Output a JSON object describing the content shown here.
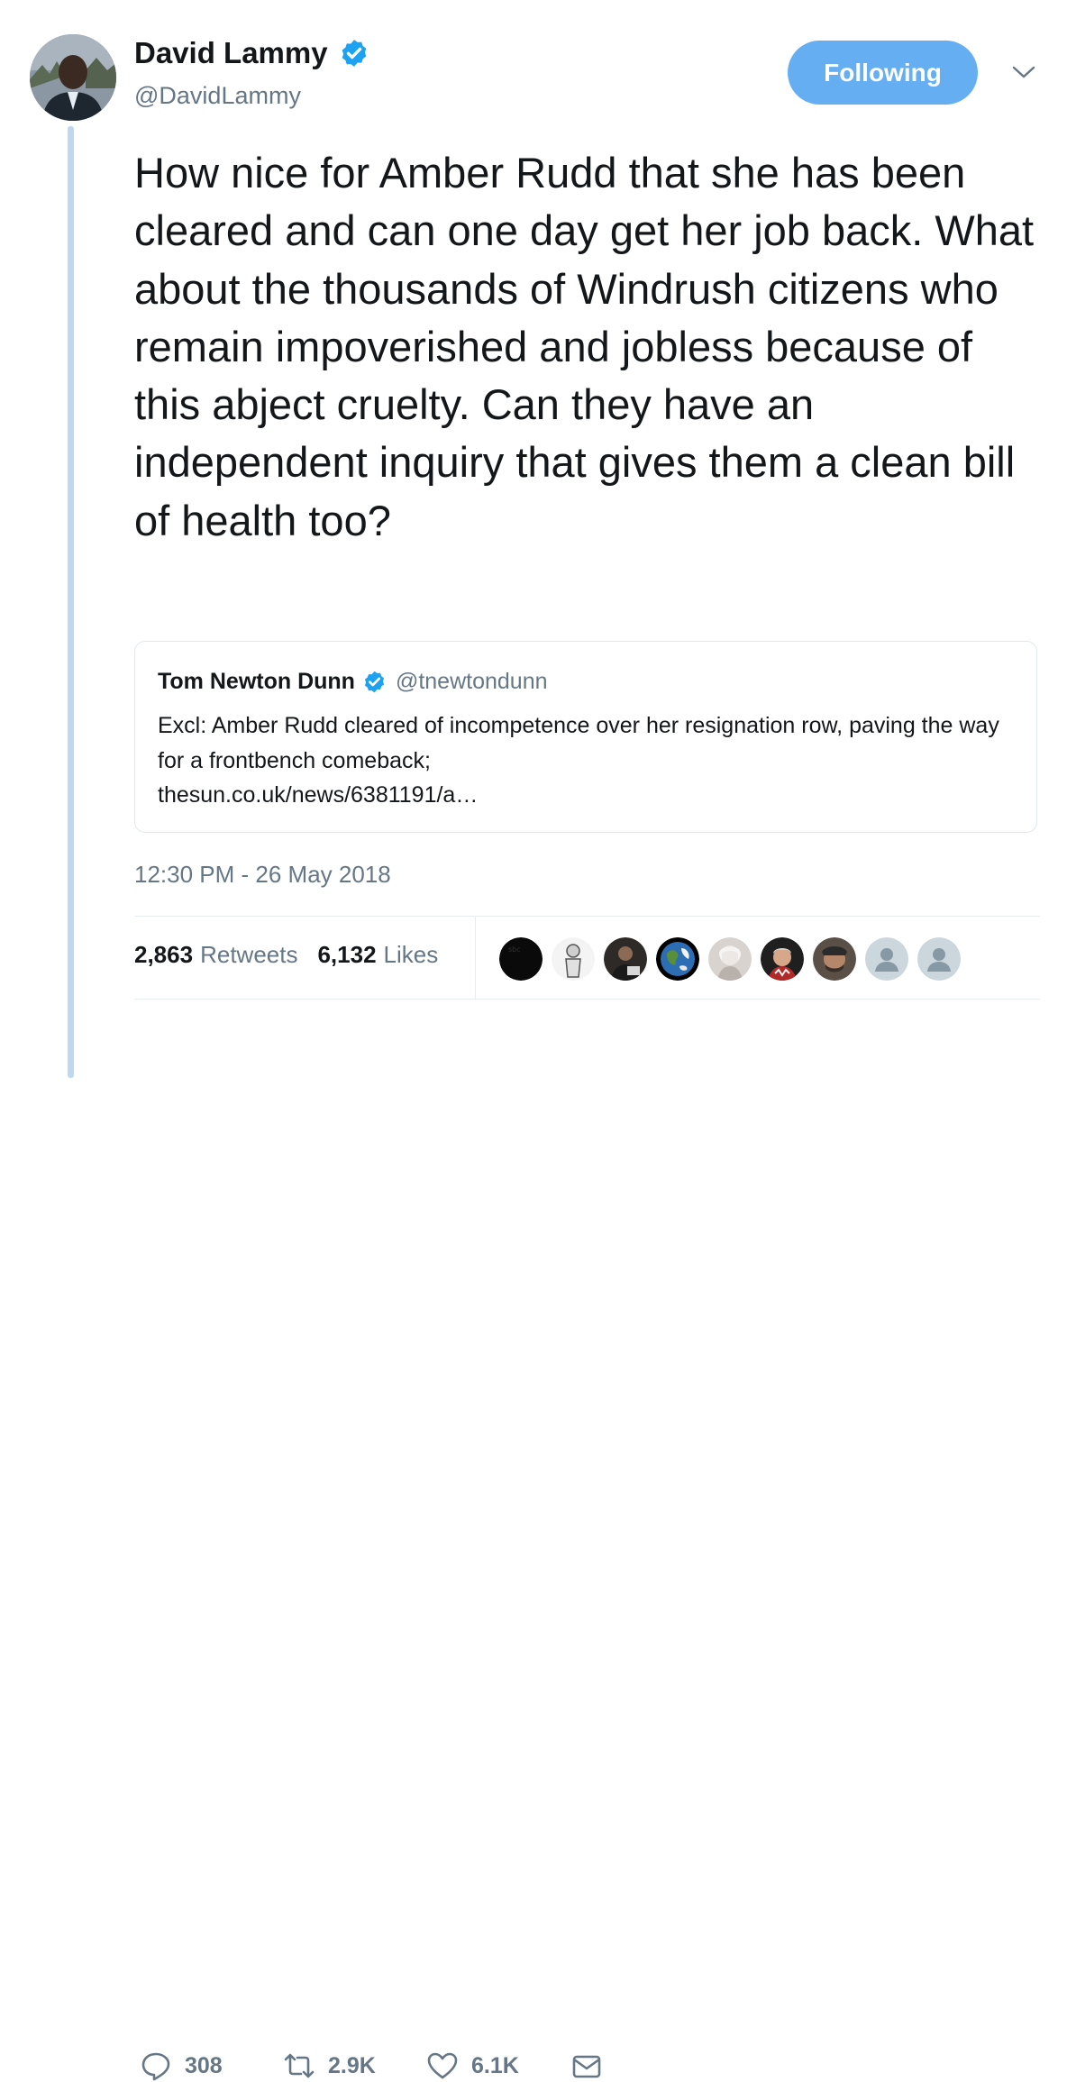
{
  "author": {
    "name": "David Lammy",
    "handle": "@DavidLammy",
    "follow_label": "Following"
  },
  "tweet": {
    "text": "How nice for Amber Rudd that she has been cleared and can one day get her job back. What about the thousands of Windrush citizens who remain impoverished and jobless because of this abject cruelty. Can they have an independent inquiry that gives them a clean bill of health too?",
    "timestamp": "12:30 PM - 26 May 2018"
  },
  "quoted": {
    "name": "Tom Newton Dunn",
    "handle": "@tnewtondunn",
    "text": "Excl: Amber Rudd cleared of incompetence over her resignation row, paving the way for a frontbench comeback;",
    "link": "thesun.co.uk/news/6381191/a…"
  },
  "stats": {
    "retweets_count": "2,863",
    "retweets_label": "Retweets",
    "likes_count": "6,132",
    "likes_label": "Likes"
  },
  "actions": {
    "reply_count": "308",
    "retweet_count": "2.9K",
    "like_count": "6.1K"
  },
  "colors": {
    "accent": "#66aef2",
    "verified": "#1da1f2",
    "secondary_text": "#657786",
    "thread_line": "#bcd9f1"
  }
}
